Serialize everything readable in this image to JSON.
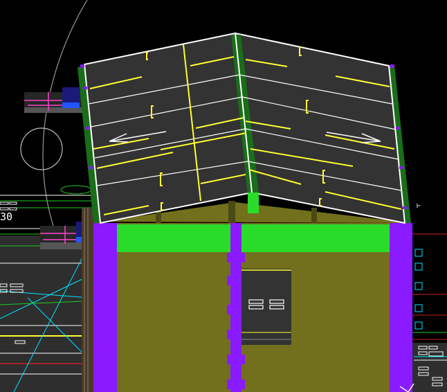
{
  "viewport": {
    "background": "#000000",
    "annotation_text": "30"
  },
  "colors": {
    "roof_surface": "#333333",
    "roof_outline": "#ffffff",
    "ridge_green": "#1a6e1a",
    "marking_yellow": "#ffff33",
    "wall_olive": "#72701c",
    "beam_green": "#2adc2a",
    "column_purple": "#8a1aff",
    "accent_pink": "#ff44cc",
    "accent_cyan": "#00e5ff",
    "accent_blue": "#2255ff",
    "navy_block": "#1a1a7a",
    "gray_line": "#9a9a9a",
    "red_line": "#cc2222"
  },
  "icons": {
    "left_arrow": "arrow-left-icon",
    "right_arrow": "arrow-right-icon",
    "close": "close-icon"
  }
}
